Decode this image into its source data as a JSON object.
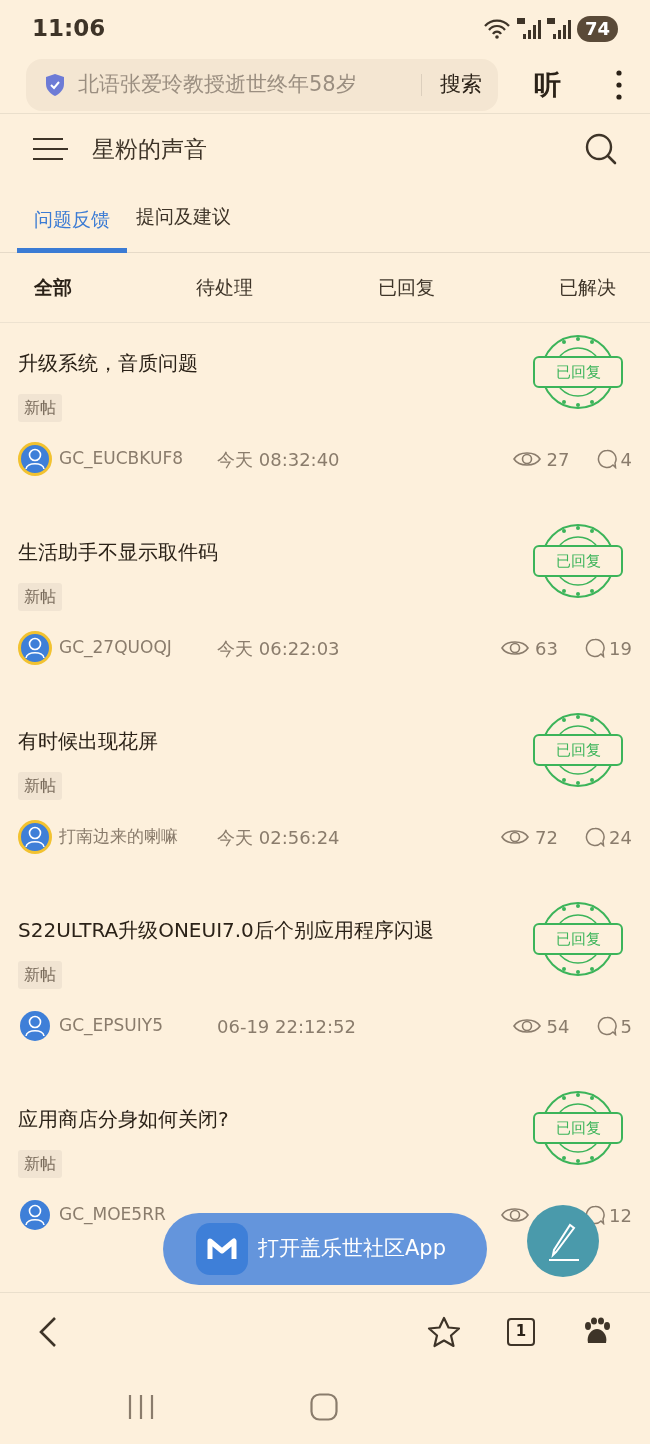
{
  "status_bar": {
    "time": "11:06",
    "battery": "74"
  },
  "browser_bar": {
    "query": "北语张爱玲教授逝世终年58岁",
    "search_button": "搜索",
    "listen_button": "听"
  },
  "header": {
    "title": "星粉的声音"
  },
  "tabs": [
    {
      "label": "问题反馈",
      "selected": true
    },
    {
      "label": "提问及建议",
      "selected": false
    }
  ],
  "filters": [
    {
      "label": "全部",
      "selected": true
    },
    {
      "label": "待处理",
      "selected": false
    },
    {
      "label": "已回复",
      "selected": false
    },
    {
      "label": "已解决",
      "selected": false
    }
  ],
  "posts": [
    {
      "title": "升级系统，音质问题",
      "tag": "新帖",
      "status": "已回复",
      "author": "GC_EUCBKUF8",
      "ringed": true,
      "time": "今天 08:32:40",
      "views": "27",
      "comments": "4"
    },
    {
      "title": "生活助手不显示取件码",
      "tag": "新帖",
      "status": "已回复",
      "author": "GC_27QUOQJ",
      "ringed": true,
      "time": "今天 06:22:03",
      "views": "63",
      "comments": "19"
    },
    {
      "title": "有时候出现花屏",
      "tag": "新帖",
      "status": "已回复",
      "author": "打南边来的喇嘛",
      "ringed": true,
      "time": "今天 02:56:24",
      "views": "72",
      "comments": "24"
    },
    {
      "title": "S22ULTRA升级ONEUI7.0后个别应用程序闪退",
      "tag": "新帖",
      "status": "已回复",
      "author": "GC_EPSUIY5",
      "ringed": false,
      "time": "06-19 22:12:52",
      "views": "54",
      "comments": "5"
    },
    {
      "title": "应用商店分身如何关闭?",
      "tag": "新帖",
      "status": "已回复",
      "author": "GC_MOE5RR",
      "ringed": false,
      "comments": "12"
    }
  ],
  "open_app_banner": {
    "label": "打开盖乐世社区App"
  },
  "bottom_bar": {
    "tab_count": "1"
  }
}
